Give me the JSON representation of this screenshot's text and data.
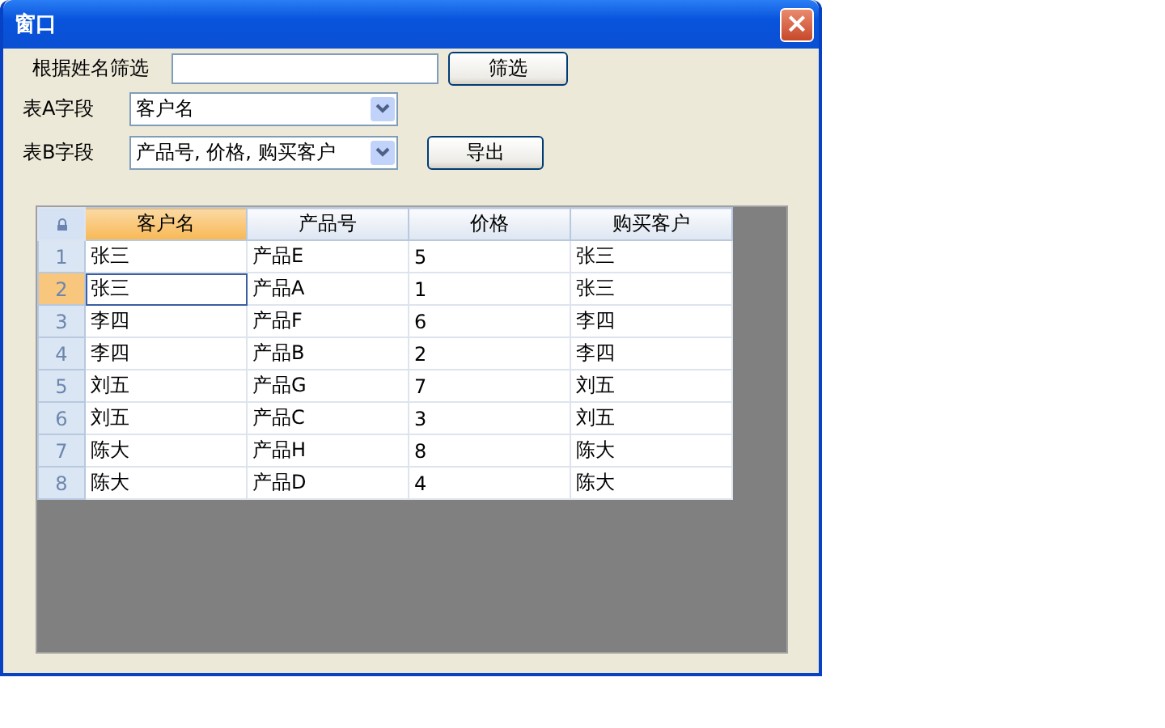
{
  "window": {
    "title": "窗口",
    "close": "×"
  },
  "filter": {
    "label": "根据姓名筛选",
    "button": "筛选"
  },
  "field_a": {
    "label": "表A字段",
    "value": "客户名"
  },
  "field_b": {
    "label": "表B字段",
    "value": "产品号, 价格, 购买客户"
  },
  "export_button": "导出",
  "table": {
    "columns": [
      {
        "label": "客户名",
        "selected": true
      },
      {
        "label": "产品号",
        "selected": false
      },
      {
        "label": "价格",
        "selected": false
      },
      {
        "label": "购买客户",
        "selected": false
      }
    ],
    "rows": [
      {
        "number": "1",
        "selected": false,
        "cells": [
          {
            "text": "张三",
            "focused": false
          },
          {
            "text": "产品E",
            "focused": false
          },
          {
            "text": "5",
            "focused": false
          },
          {
            "text": "张三",
            "focused": false
          }
        ]
      },
      {
        "number": "2",
        "selected": true,
        "cells": [
          {
            "text": "张三",
            "focused": true
          },
          {
            "text": "产品A",
            "focused": false
          },
          {
            "text": "1",
            "focused": false
          },
          {
            "text": "张三",
            "focused": false
          }
        ]
      },
      {
        "number": "3",
        "selected": false,
        "cells": [
          {
            "text": "李四",
            "focused": false
          },
          {
            "text": "产品F",
            "focused": false
          },
          {
            "text": "6",
            "focused": false
          },
          {
            "text": "李四",
            "focused": false
          }
        ]
      },
      {
        "number": "4",
        "selected": false,
        "cells": [
          {
            "text": "李四",
            "focused": false
          },
          {
            "text": "产品B",
            "focused": false
          },
          {
            "text": "2",
            "focused": false
          },
          {
            "text": "李四",
            "focused": false
          }
        ]
      },
      {
        "number": "5",
        "selected": false,
        "cells": [
          {
            "text": "刘五",
            "focused": false
          },
          {
            "text": "产品G",
            "focused": false
          },
          {
            "text": "7",
            "focused": false
          },
          {
            "text": "刘五",
            "focused": false
          }
        ]
      },
      {
        "number": "6",
        "selected": false,
        "cells": [
          {
            "text": "刘五",
            "focused": false
          },
          {
            "text": "产品C",
            "focused": false
          },
          {
            "text": "3",
            "focused": false
          },
          {
            "text": "刘五",
            "focused": false
          }
        ]
      },
      {
        "number": "7",
        "selected": false,
        "cells": [
          {
            "text": "陈大",
            "focused": false
          },
          {
            "text": "产品H",
            "focused": false
          },
          {
            "text": "8",
            "focused": false
          },
          {
            "text": "陈大",
            "focused": false
          }
        ]
      },
      {
        "number": "8",
        "selected": false,
        "cells": [
          {
            "text": "陈大",
            "focused": false
          },
          {
            "text": "产品D",
            "focused": false
          },
          {
            "text": "4",
            "focused": false
          },
          {
            "text": "陈大",
            "focused": false
          }
        ]
      }
    ]
  }
}
